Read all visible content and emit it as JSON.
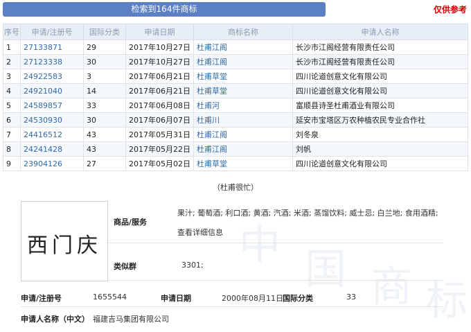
{
  "header": {
    "result_text": "检索到164件商标",
    "reference_note": "仅供参考"
  },
  "table": {
    "columns": [
      "序号",
      "申请/注册号",
      "国际分类",
      "申请日期",
      "商标名称",
      "申请人名称"
    ],
    "rows": [
      [
        "1",
        "27133871",
        "29",
        "2017年10月27日",
        "杜甫江阁",
        "长沙市江阁经营有限责任公司"
      ],
      [
        "2",
        "27123338",
        "30",
        "2017年10月27日",
        "杜甫江阁",
        "长沙市江阁经营有限责任公司"
      ],
      [
        "3",
        "24922583",
        "3",
        "2017年06月21日",
        "杜甫草堂",
        "四川论道创意文化有限公司"
      ],
      [
        "4",
        "24921040",
        "14",
        "2017年06月21日",
        "杜甫草堂",
        "四川论道创意文化有限公司"
      ],
      [
        "5",
        "24589857",
        "33",
        "2017年06月08日",
        "杜甫河",
        "富顺县诗圣杜甫酒业有限公司"
      ],
      [
        "6",
        "24530930",
        "30",
        "2017年06月07日",
        "杜甫川",
        "延安市宝塔区万农种植农民专业合作社"
      ],
      [
        "7",
        "24416512",
        "43",
        "2017年05月31日",
        "杜甫江阁",
        "刘冬泉"
      ],
      [
        "8",
        "24241428",
        "43",
        "2017年05月22日",
        "杜甫江阁",
        "刘帆"
      ],
      [
        "9",
        "23904126",
        "27",
        "2017年05月02日",
        "杜甫草堂",
        "四川论道创意文化有限公司"
      ]
    ]
  },
  "caption": "（杜甫很忙）",
  "detail": {
    "logo_text": "西门庆",
    "goods_label": "商品/服务",
    "goods_value": "果汁; 葡萄酒; 利口酒; 黄酒; 汽酒; 米酒; 蒸馏饮料; 威士忌; 白兰地; 食用酒精;",
    "detail_link": "查看详细信息",
    "group_label": "类似群",
    "group_value": "3301;",
    "reg_label": "申请/注册号",
    "reg_value": "1655544",
    "date_label": "申请日期",
    "date_value": "2000年08月11日",
    "class_label": "国际分类",
    "class_value": "33",
    "applicant_label": "申请人名称（中文）",
    "applicant_value": "福建吉马集团有限公司"
  },
  "watermark": [
    "中",
    "国",
    "商",
    "标"
  ]
}
